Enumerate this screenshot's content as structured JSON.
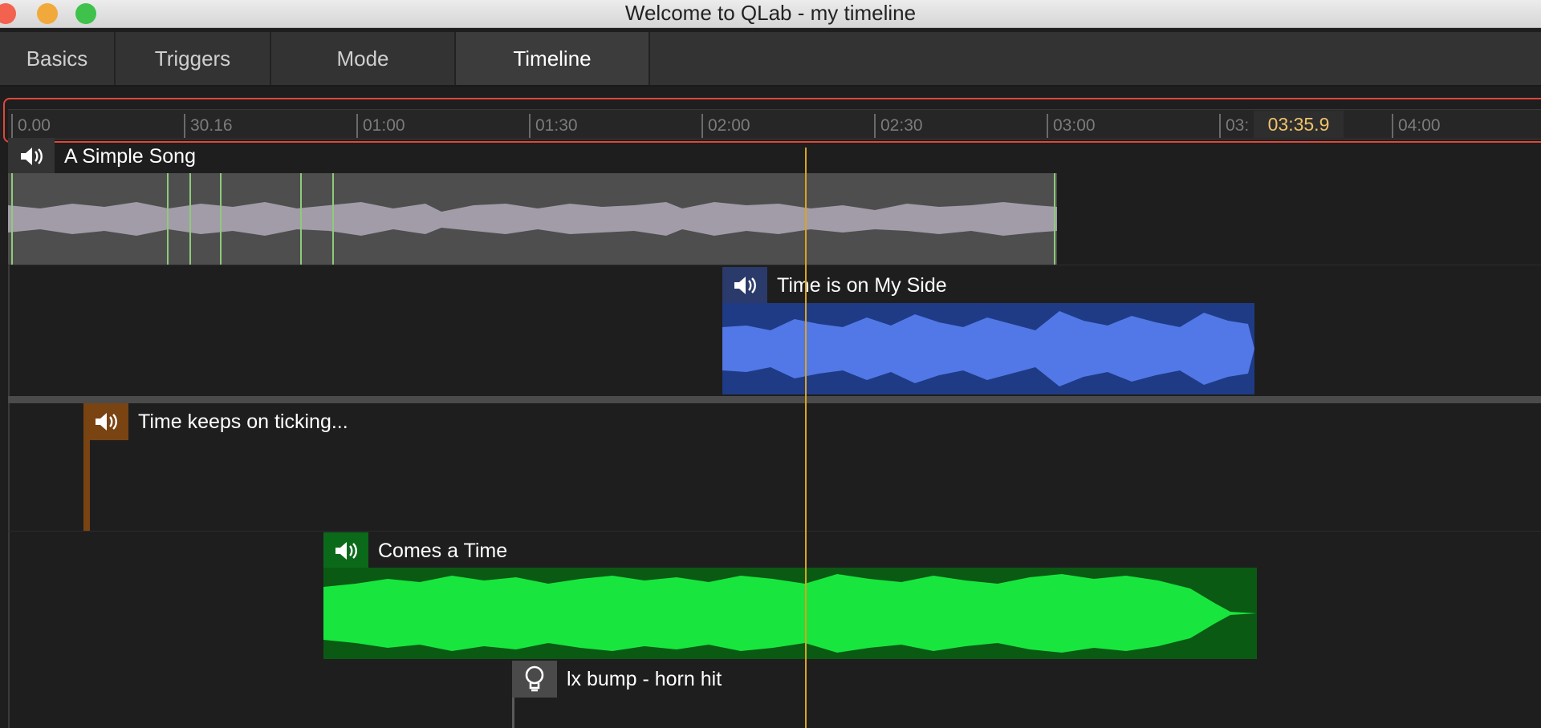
{
  "window": {
    "title": "Welcome to QLab - my timeline"
  },
  "tabs": [
    {
      "label": "Basics",
      "active": false
    },
    {
      "label": "Triggers",
      "active": false
    },
    {
      "label": "Mode",
      "active": false
    },
    {
      "label": "Timeline",
      "active": true
    }
  ],
  "ruler": {
    "ticks": [
      "0.00",
      "30.16",
      "01:00",
      "01:30",
      "02:00",
      "02:30",
      "03:00",
      "03:",
      "04:00"
    ],
    "playhead_time": "03:35.9"
  },
  "cues": [
    {
      "title": "A Simple Song",
      "type": "audio",
      "icon": "speaker-icon",
      "color": "#9a94a2"
    },
    {
      "title": "Time is on My Side",
      "type": "audio",
      "icon": "speaker-icon",
      "color": "#4f78e6"
    },
    {
      "title": "Time keeps on ticking...",
      "type": "audio",
      "icon": "speaker-icon",
      "color": "#a86a2a"
    },
    {
      "title": "Comes a Time",
      "type": "audio",
      "icon": "speaker-icon",
      "color": "#10d83a"
    },
    {
      "title": "lx bump - horn hit",
      "type": "light",
      "icon": "lightbulb-icon",
      "color": "#5a5a5a"
    }
  ],
  "colors": {
    "playhead": "#d8a421",
    "ruler_highlight": "#e0473b"
  }
}
